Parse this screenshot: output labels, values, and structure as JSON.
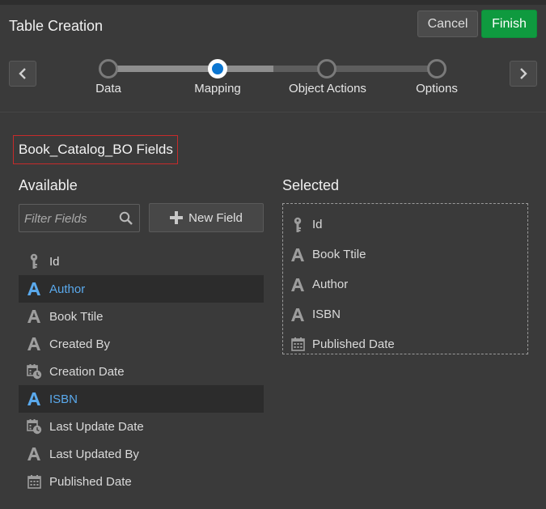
{
  "header": {
    "title": "Table Creation",
    "cancel_label": "Cancel",
    "finish_label": "Finish"
  },
  "train": {
    "steps": [
      {
        "label": "Data",
        "active": false
      },
      {
        "label": "Mapping",
        "active": true
      },
      {
        "label": "Object Actions",
        "active": false
      },
      {
        "label": "Options",
        "active": false
      }
    ]
  },
  "section": {
    "title": "Book_Catalog_BO Fields"
  },
  "available": {
    "heading": "Available",
    "filter_placeholder": "Filter Fields",
    "new_field_label": "New Field",
    "items": [
      {
        "label": "Id",
        "icon": "key-icon",
        "selected": false
      },
      {
        "label": "Author",
        "icon": "text-type-icon",
        "selected": true
      },
      {
        "label": "Book Ttile",
        "icon": "text-type-icon",
        "selected": false
      },
      {
        "label": "Created By",
        "icon": "text-type-icon",
        "selected": false
      },
      {
        "label": "Creation Date",
        "icon": "datetime-icon",
        "selected": false
      },
      {
        "label": "ISBN",
        "icon": "text-type-icon",
        "selected": true
      },
      {
        "label": "Last Update Date",
        "icon": "datetime-icon",
        "selected": false
      },
      {
        "label": "Last Updated By",
        "icon": "text-type-icon",
        "selected": false
      },
      {
        "label": "Published Date",
        "icon": "calendar-icon",
        "selected": false
      }
    ]
  },
  "selected": {
    "heading": "Selected",
    "items": [
      {
        "label": "Id",
        "icon": "key-icon"
      },
      {
        "label": "Book Ttile",
        "icon": "text-type-icon"
      },
      {
        "label": "Author",
        "icon": "text-type-icon"
      },
      {
        "label": "ISBN",
        "icon": "text-type-icon"
      },
      {
        "label": "Published Date",
        "icon": "calendar-icon"
      }
    ]
  },
  "colors": {
    "background": "#3a3a3a",
    "finish": "#0f9a3f",
    "accent": "#0c76d1",
    "selected_text": "#5aa9ec",
    "highlight_border": "#c62b2b"
  }
}
